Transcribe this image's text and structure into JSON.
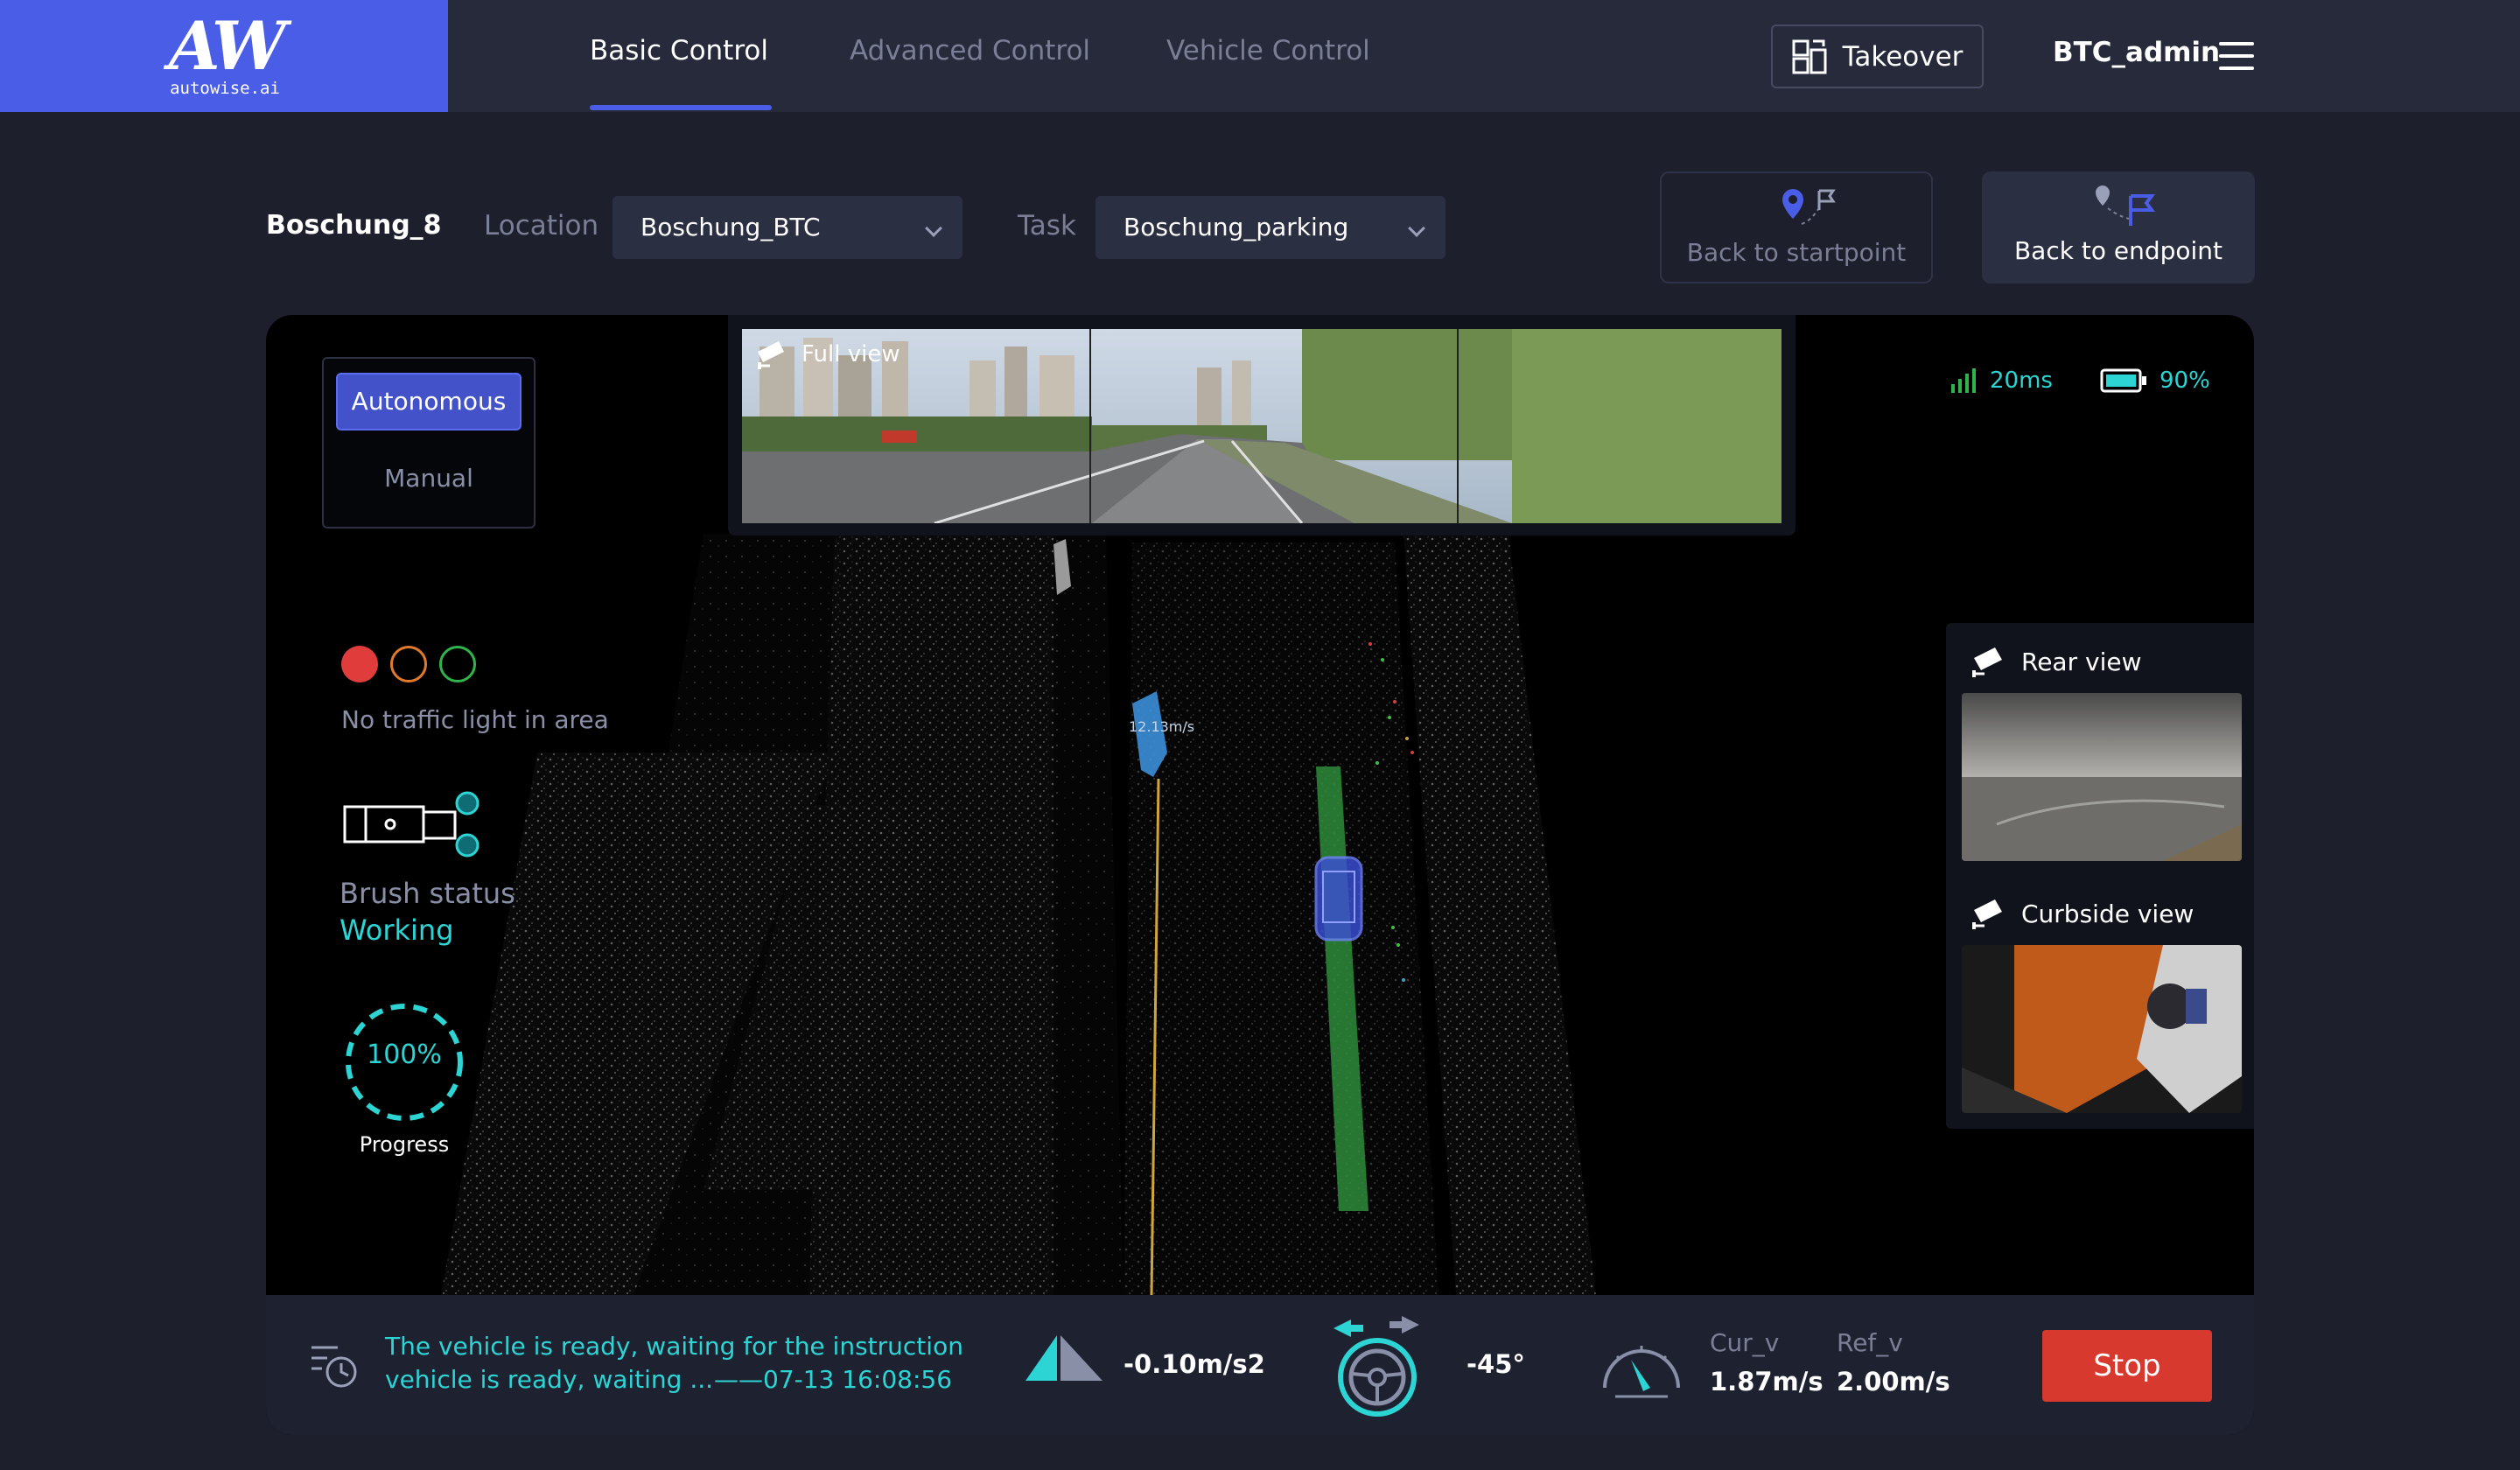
{
  "brand": {
    "logo_mark": "AW",
    "logo_sub": "autowise.ai",
    "accent_color": "#4a5de6"
  },
  "nav": {
    "tabs": [
      {
        "label": "Basic Control",
        "active": true
      },
      {
        "label": "Advanced Control",
        "active": false
      },
      {
        "label": "Vehicle Control",
        "active": false
      }
    ],
    "takeover_label": "Takeover",
    "user": "BTC_admin"
  },
  "controls": {
    "vehicle": "Boschung_8",
    "location_label": "Location",
    "location_value": "Boschung_BTC",
    "task_label": "Task",
    "task_value": "Boschung_parking",
    "back_start_label": "Back to startpoint",
    "back_end_label": "Back to endpoint"
  },
  "viewport": {
    "mode": {
      "autonomous": "Autonomous",
      "manual": "Manual",
      "selected": "Autonomous"
    },
    "traffic_light": {
      "text": "No traffic light in area",
      "colors": [
        "#e03c3c",
        "#e07a2a",
        "#2fb34a"
      ]
    },
    "brush": {
      "label": "Brush status",
      "value": "Working"
    },
    "progress": {
      "value": "100%",
      "label": "Progress",
      "fraction": 1.0
    },
    "full_view_label": "Full view",
    "object_speed": "12.13m/s",
    "latency": "20ms",
    "battery": "90%",
    "battery_fraction": 0.9,
    "rear_view_label": "Rear view",
    "curbside_view_label": "Curbside view"
  },
  "bottom": {
    "message": "The vehicle is ready, waiting for the instruction",
    "message_short": "vehicle is ready, waiting ...",
    "timestamp": "——07-13 16:08:56",
    "acceleration": "-0.10m/s2",
    "steering": "-45°",
    "cur_label": "Cur_v",
    "cur_value": "1.87m/s",
    "ref_label": "Ref_v",
    "ref_value": "2.00m/s",
    "stop_label": "Stop"
  },
  "icons": [
    "menu-icon",
    "takeover-icon",
    "location-pin-icon",
    "flag-icon",
    "camera-icon",
    "signal-icon",
    "battery-icon",
    "history-icon",
    "acceleration-icon",
    "steering-wheel-icon",
    "speedometer-icon",
    "brush-vehicle-icon",
    "chevron-down-icon"
  ]
}
